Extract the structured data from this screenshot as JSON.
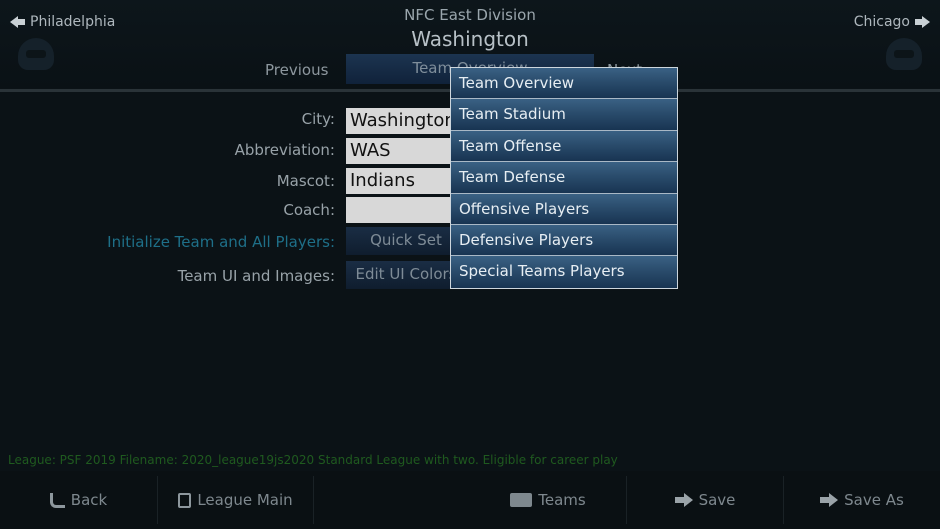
{
  "header": {
    "prev_team": "Philadelphia",
    "next_team": "Chicago",
    "division": "NFC East Division",
    "team": "Washington",
    "tab_prev": "Previous",
    "tab_current": "Team Overview",
    "tab_next": "Next"
  },
  "form": {
    "city_label": "City:",
    "city_value": "Washington",
    "abbr_label": "Abbreviation:",
    "abbr_value": "WAS",
    "mascot_label": "Mascot:",
    "mascot_value": "Indians",
    "coach_label": "Coach:",
    "coach_value": "",
    "init_label": "Initialize Team and All Players:",
    "init_button": "Quick Set",
    "ui_label": "Team UI and Images:",
    "ui_button": "Edit UI Colors"
  },
  "dropdown": {
    "items": [
      "Team Overview",
      "Team Stadium",
      "Team Offense",
      "Team Defense",
      "Offensive Players",
      "Defensive Players",
      "Special Teams Players"
    ]
  },
  "status_line": "League: PSF 2019  Filename: 2020_league19js2020  Standard League with two. Eligible for career play",
  "footer": {
    "back": "Back",
    "league_main": "League Main",
    "teams": "Teams",
    "save": "Save",
    "save_as": "Save As"
  },
  "icons": {
    "prev_arrow": "arrow-left-icon",
    "next_arrow": "arrow-right-icon",
    "back": "back-arrow-icon",
    "league_main": "clipboard-icon",
    "teams": "bus-icon",
    "save": "arrow-right-icon",
    "save_as": "arrow-right-icon"
  },
  "colors": {
    "background": "#0b1216",
    "dropdown_item": "#2a4c6c",
    "link_teal": "#1e6f88",
    "status_green": "#1f5a1f"
  }
}
